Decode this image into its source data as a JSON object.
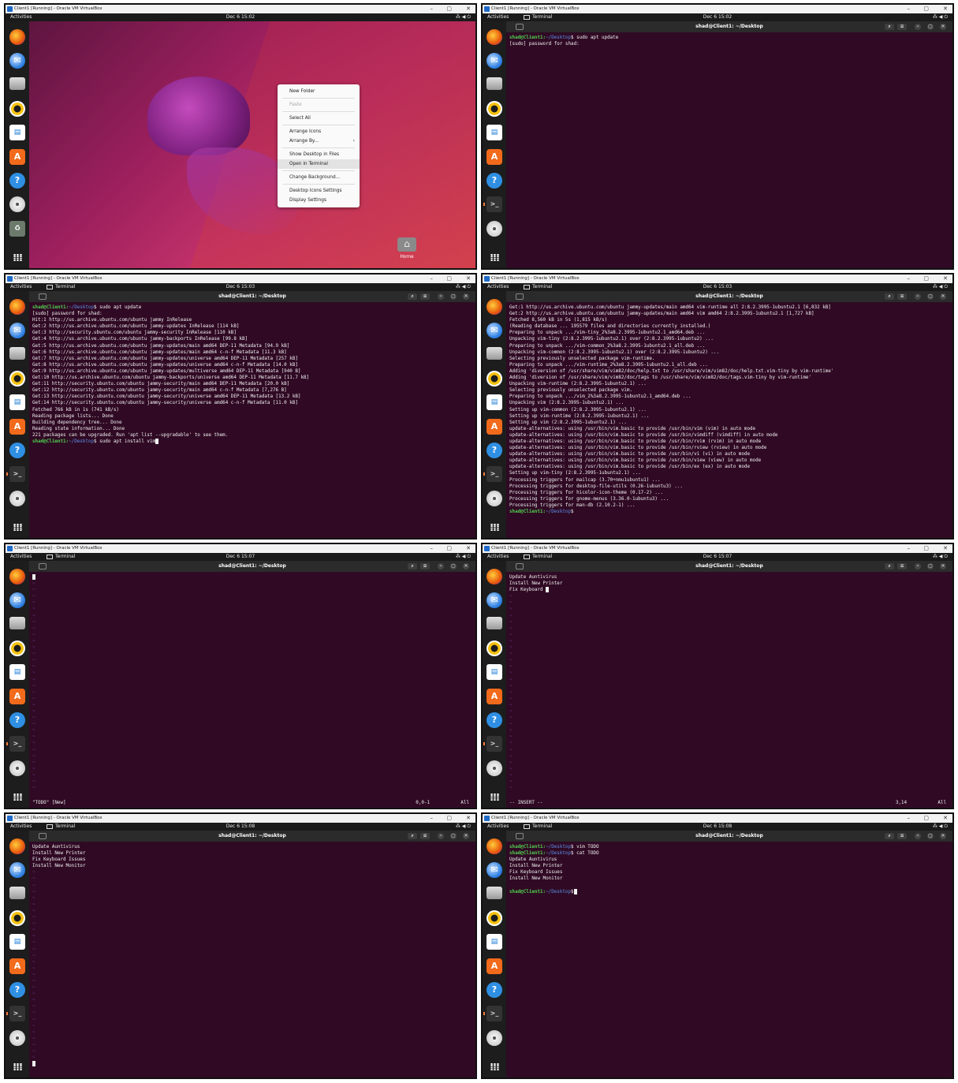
{
  "vbox": {
    "title": "Client1 [Running] - Oracle VM VirtualBox",
    "min": "–",
    "max": "▢",
    "close": "✕"
  },
  "topbar": {
    "activities": "Activities",
    "app": "Terminal",
    "tray": "⁂ ◀ ⏻"
  },
  "clocks": [
    "Dec 6 15:02",
    "Dec 6 15:02",
    "Dec 6 15:03",
    "Dec 6 15:03",
    "Dec 6 15:07",
    "Dec 6 15:07",
    "Dec 6 15:08",
    "Dec 6 15:08"
  ],
  "terminal": {
    "title": "shad@Client1: ~/Desktop",
    "search": "⌕",
    "menu": "≡",
    "minimize": "–",
    "maximize": "▢",
    "close": "✕"
  },
  "prompt": {
    "user": "shad@Client1:",
    "path": "~/Desktop",
    "sign": "$"
  },
  "desktop": {
    "menu": [
      "New Folder",
      "Paste",
      "Select All",
      "Arrange Icons",
      "Arrange By...",
      "Show Desktop in Files",
      "Open in Terminal",
      "Change Background...",
      "Desktop Icons Settings",
      "Display Settings"
    ],
    "arrow": "›",
    "home_label": "Home"
  },
  "panel2": {
    "cmd": " sudo apt update",
    "lines": [
      "[sudo] password for shad:"
    ]
  },
  "panel3": {
    "cmd1": " sudo apt update",
    "lines": [
      "[sudo] password for shad:",
      "Hit:1 http://us.archive.ubuntu.com/ubuntu jammy InRelease",
      "Get:2 http://us.archive.ubuntu.com/ubuntu jammy-updates InRelease [114 kB]",
      "Get:3 http://security.ubuntu.com/ubuntu jammy-security InRelease [110 kB]",
      "Get:4 http://us.archive.ubuntu.com/ubuntu jammy-backports InRelease [99.8 kB]",
      "Get:5 http://us.archive.ubuntu.com/ubuntu jammy-updates/main amd64 DEP-11 Metadata [94.9 kB]",
      "Get:6 http://us.archive.ubuntu.com/ubuntu jammy-updates/main amd64 c-n-f Metadata [11.3 kB]",
      "Get:7 http://us.archive.ubuntu.com/ubuntu jammy-updates/universe amd64 DEP-11 Metadata [257 kB]",
      "Get:8 http://us.archive.ubuntu.com/ubuntu jammy-updates/universe amd64 c-n-f Metadata [14.0 kB]",
      "Get:9 http://us.archive.ubuntu.com/ubuntu jammy-updates/multiverse amd64 DEP-11 Metadata [940 B]",
      "Get:10 http://us.archive.ubuntu.com/ubuntu jammy-backports/universe amd64 DEP-11 Metadata [11.7 kB]",
      "Get:11 http://security.ubuntu.com/ubuntu jammy-security/main amd64 DEP-11 Metadata [20.0 kB]",
      "Get:12 http://security.ubuntu.com/ubuntu jammy-security/main amd64 c-n-f Metadata [7,276 B]",
      "Get:13 http://security.ubuntu.com/ubuntu jammy-security/universe amd64 DEP-11 Metadata [13.2 kB]",
      "Get:14 http://security.ubuntu.com/ubuntu jammy-security/universe amd64 c-n-f Metadata [11.0 kB]",
      "Fetched 766 kB in 1s (741 kB/s)",
      "Reading package lists... Done",
      "Building dependency tree... Done",
      "Reading state information... Done",
      "221 packages can be upgraded. Run 'apt list --upgradable' to see them."
    ],
    "cmd2": " sudo apt install vim"
  },
  "panel4": {
    "lines": [
      "Get:1 http://us.archive.ubuntu.com/ubuntu jammy-updates/main amd64 vim-runtime all 2:8.2.3995-1ubuntu2.1 [6,832 kB]",
      "Get:2 http://us.archive.ubuntu.com/ubuntu jammy-updates/main amd64 vim amd64 2:8.2.3995-1ubuntu2.1 [1,727 kB]",
      "Fetched 8,560 kB in 5s (1,815 kB/s)",
      "(Reading database ... 195579 files and directories currently installed.)",
      "Preparing to unpack .../vim-tiny_2%3a8.2.3995-1ubuntu2.1_amd64.deb ...",
      "Unpacking vim-tiny (2:8.2.3995-1ubuntu2.1) over (2:8.2.3995-1ubuntu2) ...",
      "Preparing to unpack .../vim-common_2%3a8.2.3995-1ubuntu2.1_all.deb ...",
      "Unpacking vim-common (2:8.2.3995-1ubuntu2.1) over (2:8.2.3995-1ubuntu2) ...",
      "Selecting previously unselected package vim-runtime.",
      "Preparing to unpack .../vim-runtime_2%3a8.2.3995-1ubuntu2.1_all.deb ...",
      "Adding 'diversion of /usr/share/vim/vim82/doc/help.txt to /usr/share/vim/vim82/doc/help.txt.vim-tiny by vim-runtime'",
      "Adding 'diversion of /usr/share/vim/vim82/doc/tags to /usr/share/vim/vim82/doc/tags.vim-tiny by vim-runtime'",
      "Unpacking vim-runtime (2:8.2.3995-1ubuntu2.1) ...",
      "Selecting previously unselected package vim.",
      "Preparing to unpack .../vim_2%3a8.2.3995-1ubuntu2.1_amd64.deb ...",
      "Unpacking vim (2:8.2.3995-1ubuntu2.1) ...",
      "Setting up vim-common (2:8.2.3995-1ubuntu2.1) ...",
      "Setting up vim-runtime (2:8.2.3995-1ubuntu2.1) ...",
      "Setting up vim (2:8.2.3995-1ubuntu2.1) ...",
      "update-alternatives: using /usr/bin/vim.basic to provide /usr/bin/vim (vim) in auto mode",
      "update-alternatives: using /usr/bin/vim.basic to provide /usr/bin/vimdiff (vimdiff) in auto mode",
      "update-alternatives: using /usr/bin/vim.basic to provide /usr/bin/rvim (rvim) in auto mode",
      "update-alternatives: using /usr/bin/vim.basic to provide /usr/bin/rview (rview) in auto mode",
      "update-alternatives: using /usr/bin/vim.basic to provide /usr/bin/vi (vi) in auto mode",
      "update-alternatives: using /usr/bin/vim.basic to provide /usr/bin/view (view) in auto mode",
      "update-alternatives: using /usr/bin/vim.basic to provide /usr/bin/ex (ex) in auto mode",
      "Setting up vim-tiny (2:8.2.3995-1ubuntu2.1) ...",
      "Processing triggers for mailcap (3.70+nmu1ubuntu1) ...",
      "Processing triggers for desktop-file-utils (0.26-1ubuntu3) ...",
      "Processing triggers for hicolor-icon-theme (0.17-2) ...",
      "Processing triggers for gnome-menus (3.36.0-1ubuntu3) ...",
      "Processing triggers for man-db (2.10.2-1) ..."
    ]
  },
  "panel5": {
    "status_left": "\"TODO\" [New]",
    "status_pos": "0,0-1",
    "status_all": "All"
  },
  "panel6": {
    "lines": [
      "Update Auntivirus",
      "Install New Printer",
      "Fix Keyboard "
    ],
    "status_left": "-- INSERT --",
    "status_pos": "3,14",
    "status_all": "All"
  },
  "panel7": {
    "lines": [
      "Update Auntivirus",
      "Install New Printer",
      "Fix Keyboard Issues",
      "Install New Monitor"
    ]
  },
  "panel8": {
    "cmd1": " vim TODO",
    "cmd2": " cat TODO",
    "lines": [
      "Update Auntivirus",
      "Install New Printer",
      "Fix Keyboard Issues",
      "Install New Monitor"
    ]
  },
  "vim": {
    "tilde": "~"
  },
  "dock_icons": [
    "firefox-icon",
    "thunderbird-icon",
    "files-icon",
    "rhythmbox-icon",
    "libreoffice-writer-icon",
    "software-icon",
    "help-icon",
    "terminal-icon",
    "cd-icon",
    "trash-icon",
    "show-apps-icon"
  ]
}
